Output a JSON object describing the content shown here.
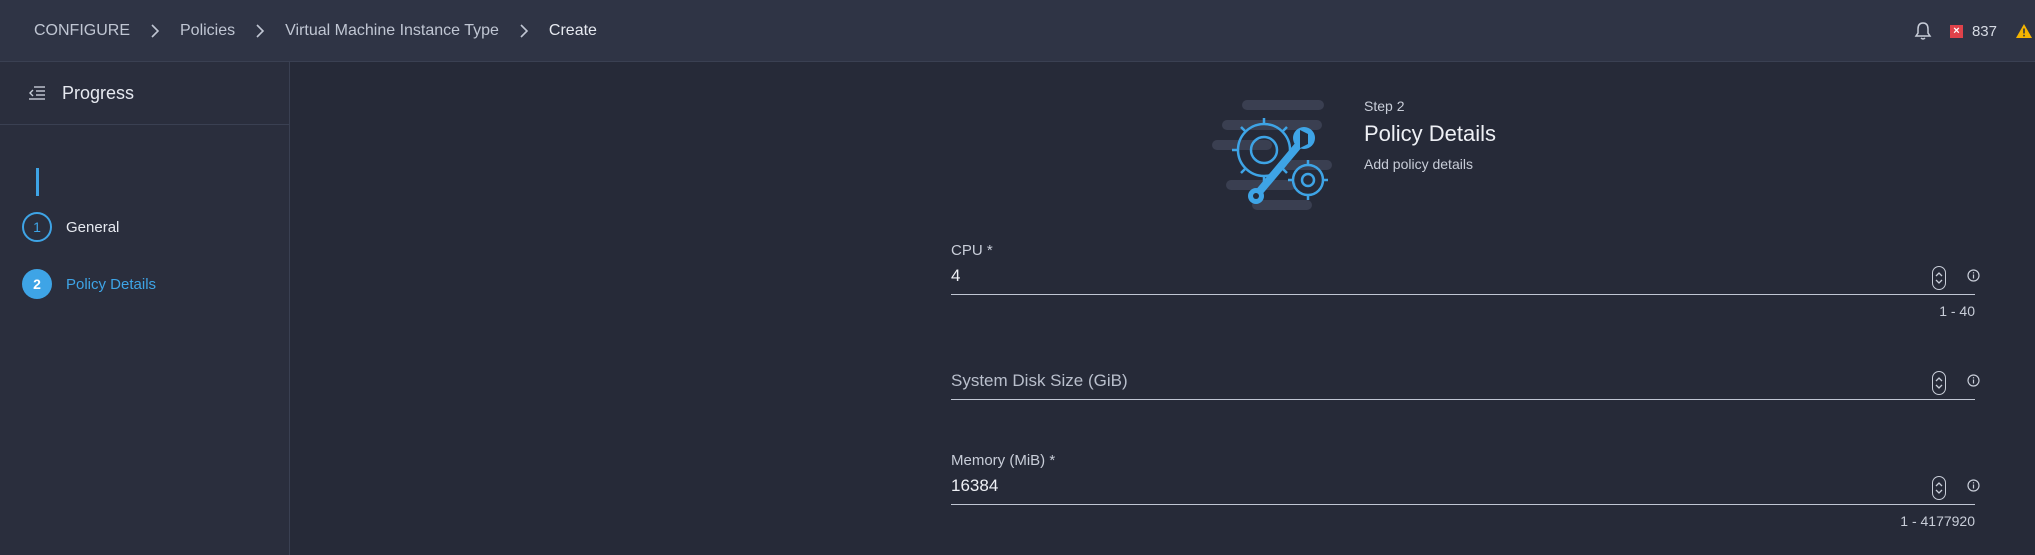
{
  "breadcrumb": {
    "items": [
      "CONFIGURE",
      "Policies",
      "Virtual Machine Instance Type",
      "Create"
    ]
  },
  "topbar": {
    "alarm_count": "837",
    "alarm_icon": "critical-alarm-icon",
    "warning_icon": "warning-triangle-icon",
    "notification_icon": "bell-icon"
  },
  "sidebar": {
    "title": "Progress",
    "steps": [
      {
        "number": "1",
        "label": "General",
        "state": "completed"
      },
      {
        "number": "2",
        "label": "Policy Details",
        "state": "active"
      }
    ]
  },
  "wizard": {
    "step_number": "Step 2",
    "title": "Policy Details",
    "subtitle": "Add policy details"
  },
  "fields": {
    "cpu": {
      "label": "CPU *",
      "value": "4",
      "range": "1 - 40"
    },
    "disk": {
      "label": "",
      "placeholder": "System Disk Size (GiB)",
      "value": ""
    },
    "memory": {
      "label": "Memory (MiB) *",
      "value": "16384",
      "range": "1 - 4177920"
    }
  },
  "colors": {
    "background": "#262a38",
    "topbar": "#2f3445",
    "sidebar": "#2a2e3d",
    "accent": "#3ea4e6",
    "critical": "#e0424a",
    "warning": "#f5b400"
  }
}
